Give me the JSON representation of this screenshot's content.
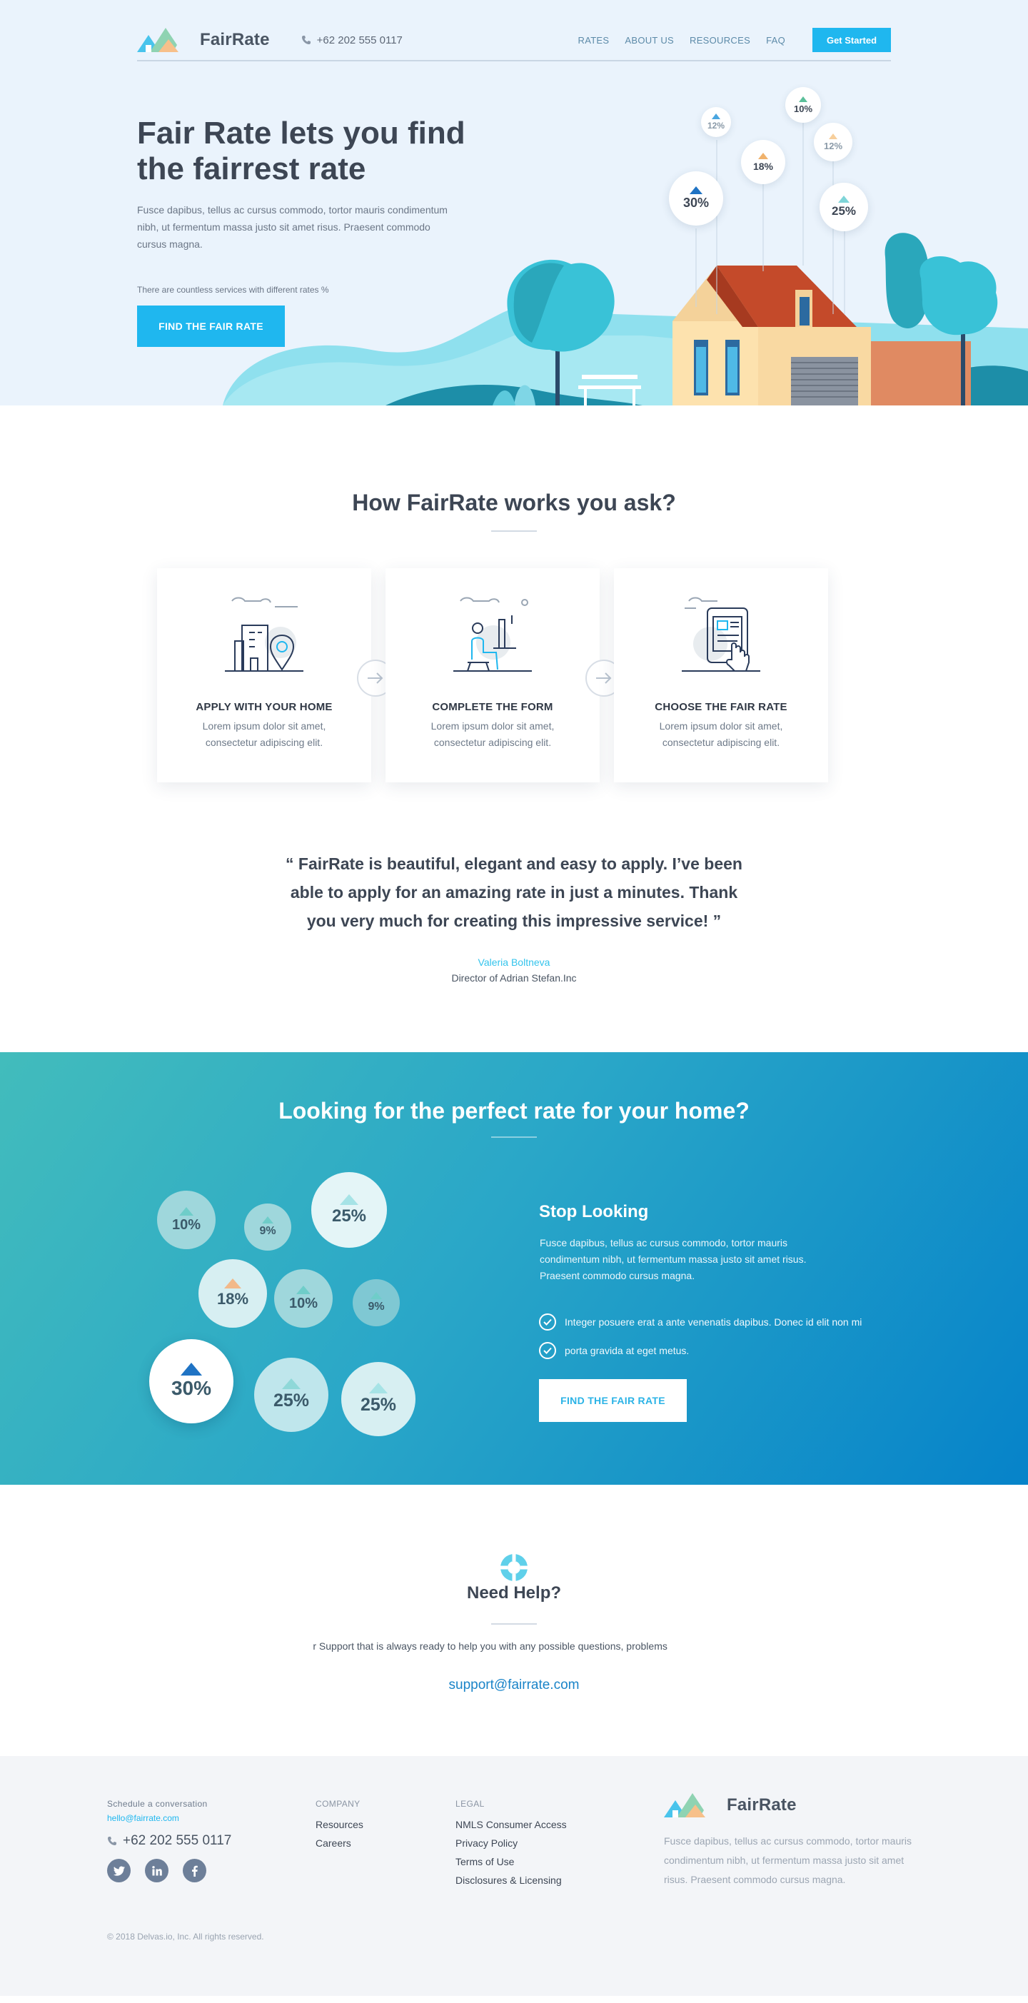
{
  "header": {
    "brand": "FairRate",
    "phone": "+62 202 555 0117",
    "nav": [
      "RATES",
      "ABOUT US",
      "RESOURCES",
      "FAQ"
    ],
    "cta": "Get Started"
  },
  "hero": {
    "title": "Fair Rate lets you find the fairrest rate",
    "description": "Fusce dapibus, tellus ac cursus commodo, tortor mauris condimentum nibh, ut fermentum massa justo sit amet risus. Praesent commodo cursus magna.",
    "note": "There are countless services with different rates %",
    "cta": "FIND THE FAIR RATE",
    "rate_bubbles": [
      "12%",
      "10%",
      "18%",
      "12%",
      "30%",
      "25%"
    ]
  },
  "how": {
    "title": "How FairRate works you ask?",
    "steps": [
      {
        "title": "APPLY WITH YOUR HOME",
        "desc": "Lorem ipsum dolor sit amet, consectetur adipiscing elit."
      },
      {
        "title": "COMPLETE THE FORM",
        "desc": "Lorem ipsum dolor sit amet, consectetur adipiscing elit."
      },
      {
        "title": "CHOOSE THE FAIR RATE",
        "desc": "Lorem ipsum dolor sit amet, consectetur adipiscing elit."
      }
    ],
    "quote": "“ FairRate is beautiful, elegant and easy to apply. I’ve been able to apply for an amazing rate in just a minutes. Thank you very much for creating this impressive service! ”",
    "quote_name": "Valeria Boltneva",
    "quote_role": "Director of Adrian Stefan.Inc"
  },
  "perfect": {
    "title": "Looking for the perfect rate for your home?",
    "bubbles": [
      "10%",
      "9%",
      "25%",
      "18%",
      "10%",
      "9%",
      "30%",
      "25%",
      "25%"
    ],
    "stop_title": "Stop Looking",
    "stop_desc": "Fusce dapibus, tellus ac cursus commodo, tortor mauris condimentum nibh, ut fermentum massa justo sit amet risus. Praesent commodo cursus magna.",
    "checks": [
      "Integer posuere erat a ante venenatis dapibus. Donec id elit non mi",
      "porta gravida at eget metus."
    ],
    "cta": "FIND THE FAIR RATE"
  },
  "help": {
    "title": "Need Help?",
    "text": "Our Customer Support that is always ready to help you with any possible questions, problems",
    "email": "support@fairrate.com"
  },
  "footer": {
    "schedule_label": "Schedule a conversation",
    "email": "hello@fairrate.com",
    "phone": "+62 202 555 0117",
    "socials": [
      "twitter-icon",
      "linkedin-icon",
      "facebook-icon"
    ],
    "company_head": "COMPANY",
    "company_links": [
      "Resources",
      "Careers"
    ],
    "legal_head": "LEGAL",
    "legal_links": [
      "NMLS Consumer Access",
      "Privacy Policy",
      "Terms of Use",
      "Disclosures & Licensing"
    ],
    "brand": "FairRate",
    "brand_desc": "Fusce dapibus, tellus ac cursus commodo, tortor mauris condimentum nibh, ut fermentum massa justo sit amet risus. Praesent commodo cursus magna.",
    "copyright": "© 2018 Delvas.io, Inc. All rights reserved."
  },
  "colors": {
    "accent": "#1fb7ef",
    "hero_bg": "#eaf3fc",
    "teal_gradient_start": "#42bcbc",
    "teal_gradient_end": "#0683c9",
    "footer_bg": "#f3f5f8"
  }
}
